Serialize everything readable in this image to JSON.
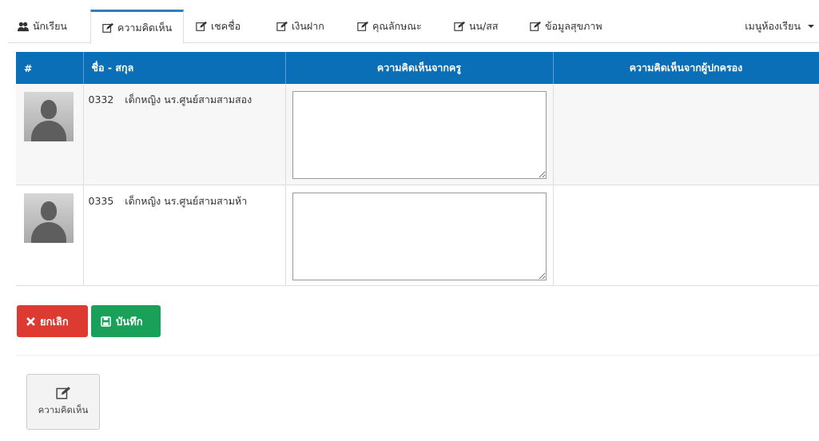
{
  "tabs": [
    {
      "label": "นักเรียน",
      "icon": "users-icon"
    },
    {
      "label": "ความคิดเห็น",
      "icon": "edit-icon"
    },
    {
      "label": "เชคชื่อ",
      "icon": "edit-icon"
    },
    {
      "label": "เงินฝาก",
      "icon": "edit-icon"
    },
    {
      "label": "คุณลักษณะ",
      "icon": "edit-icon"
    },
    {
      "label": "นน/สส",
      "icon": "edit-icon"
    },
    {
      "label": "ข้อมูลสุขภาพ",
      "icon": "edit-icon"
    }
  ],
  "menu": {
    "label": "เมนูห้องเรียน"
  },
  "table": {
    "headers": {
      "num": "#",
      "name": "ชื่อ - สกุล",
      "teacher": "ความคิดเห็นจากครู",
      "parent": "ความคิดเห็นจากผู้ปกครอง"
    },
    "rows": [
      {
        "code": "0332",
        "name": "เด็กหญิง นร.ศูนย์สามสามสอง",
        "teacher_comment": "",
        "parent_comment": ""
      },
      {
        "code": "0335",
        "name": "เด็กหญิง นร.ศูนย์สามสามห้า",
        "teacher_comment": "",
        "parent_comment": ""
      }
    ]
  },
  "buttons": {
    "cancel": "ยกเลิก",
    "save": "บันทึก"
  },
  "tile": {
    "label": "ความคิดเห็น"
  },
  "colors": {
    "header": "#0b6fb8",
    "cancel": "#dd3a31",
    "save": "#19a15a",
    "active_tab": "#2f7fc1"
  }
}
